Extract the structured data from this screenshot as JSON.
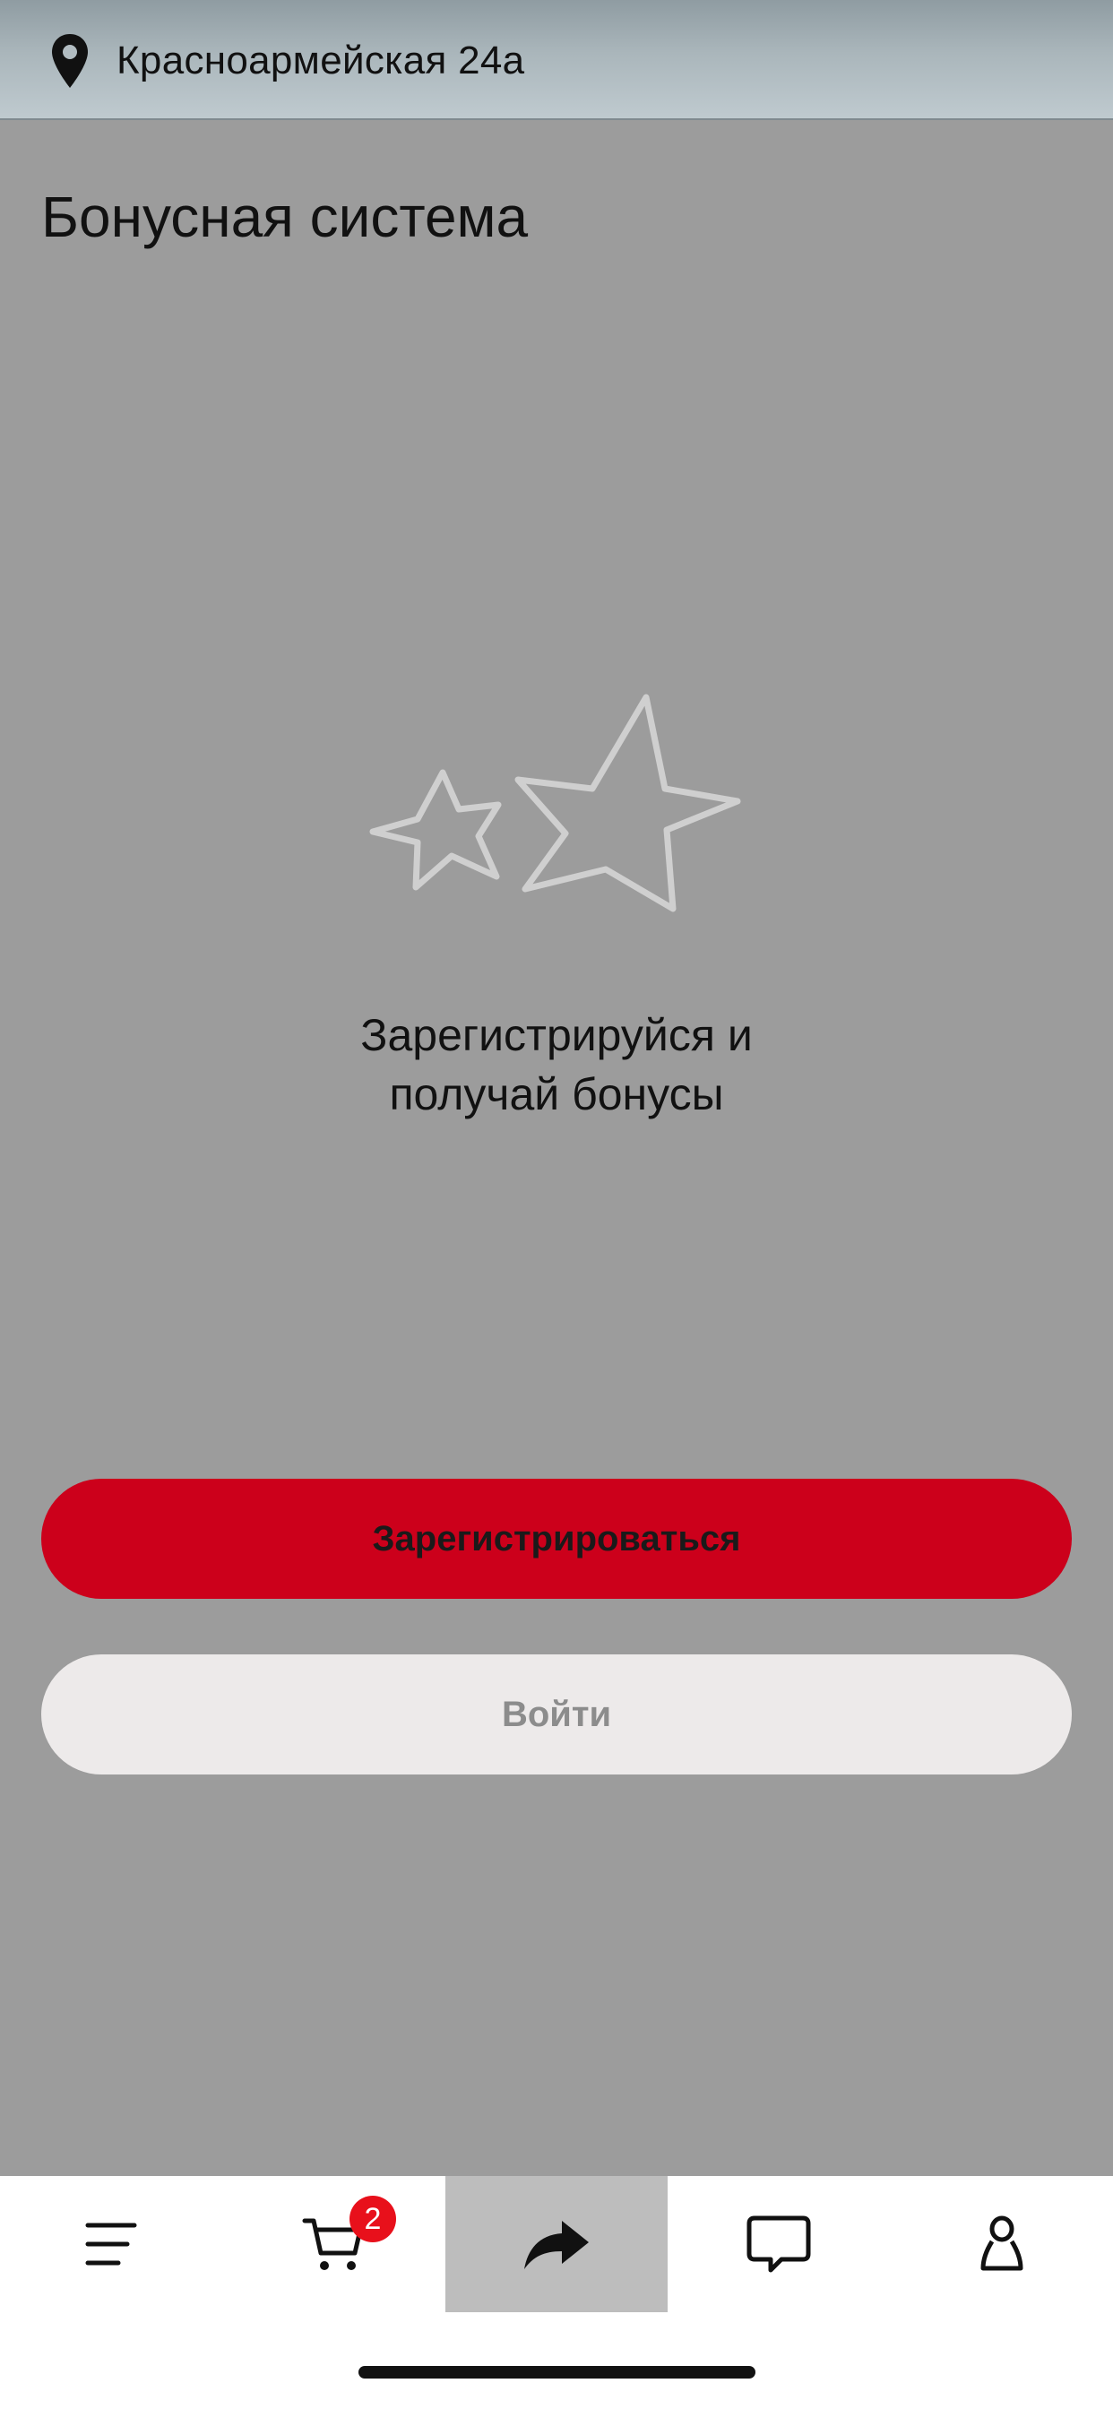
{
  "header": {
    "address": "Красноармейская 24а",
    "icon": "location-pin-icon"
  },
  "page": {
    "title": "Бонусная система"
  },
  "promo": {
    "icon": "stars-icon",
    "line1": "Зарегистрируйся и",
    "line2": "получай бонусы"
  },
  "actions": {
    "register_label": "Зарегистрироваться",
    "login_label": "Войти"
  },
  "tabbar": {
    "items": [
      {
        "icon": "menu-icon",
        "active": false
      },
      {
        "icon": "cart-icon",
        "active": false,
        "badge": "2"
      },
      {
        "icon": "share-icon",
        "active": true
      },
      {
        "icon": "chat-icon",
        "active": false
      },
      {
        "icon": "profile-icon",
        "active": false
      }
    ]
  },
  "colors": {
    "accent": "#cc001b",
    "badge": "#e8101b",
    "overlay": "#9c9c9c",
    "login_button": "#edeaea",
    "active_tab": "#bdbdbd"
  }
}
